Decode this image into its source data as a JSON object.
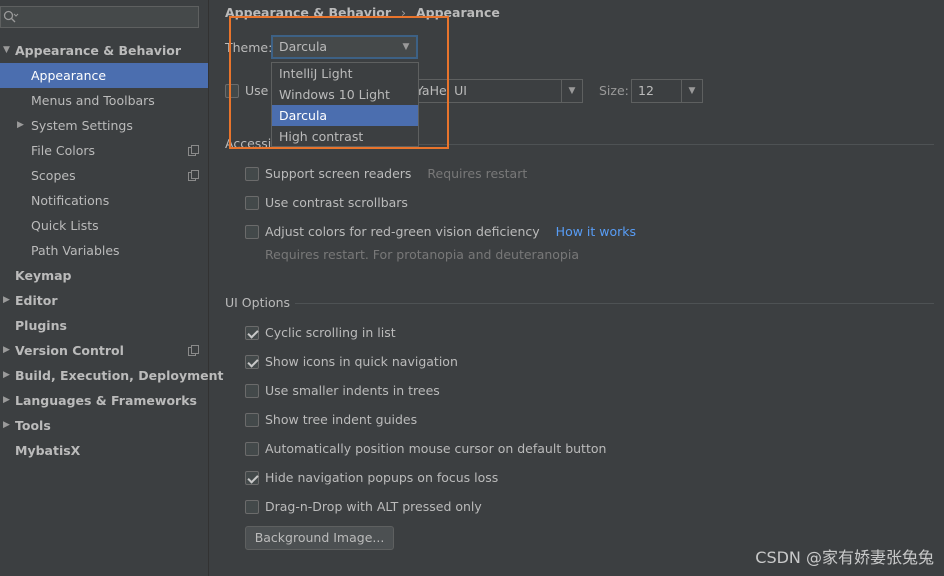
{
  "sidebar": {
    "search_placeholder": "",
    "items": [
      {
        "label": "Appearance & Behavior",
        "expanded": true
      },
      {
        "label": "Appearance"
      },
      {
        "label": "Menus and Toolbars"
      },
      {
        "label": "System Settings"
      },
      {
        "label": "File Colors"
      },
      {
        "label": "Scopes"
      },
      {
        "label": "Notifications"
      },
      {
        "label": "Quick Lists"
      },
      {
        "label": "Path Variables"
      },
      {
        "label": "Keymap"
      },
      {
        "label": "Editor"
      },
      {
        "label": "Plugins"
      },
      {
        "label": "Version Control"
      },
      {
        "label": "Build, Execution, Deployment"
      },
      {
        "label": "Languages & Frameworks"
      },
      {
        "label": "Tools"
      },
      {
        "label": "MybatisX"
      }
    ]
  },
  "breadcrumb": {
    "parent": "Appearance & Behavior",
    "separator": "›",
    "current": "Appearance"
  },
  "theme": {
    "label": "Theme:",
    "selected": "Darcula",
    "options": [
      "IntelliJ Light",
      "Windows 10 Light",
      "Darcula",
      "High contrast"
    ],
    "highlighted_option": "Darcula"
  },
  "font": {
    "use_custom_label_visible": "Use",
    "font_value_visible": "YaHei UI",
    "size_label": "Size:",
    "size_value": "12"
  },
  "accessibility": {
    "title_visible": "Accessi",
    "options": [
      {
        "label": "Support screen readers",
        "checked": false,
        "hint": "Requires restart"
      },
      {
        "label": "Use contrast scrollbars",
        "checked": false
      },
      {
        "label": "Adjust colors for red-green vision deficiency",
        "checked": false,
        "link": "How it works",
        "note": "Requires restart. For protanopia and deuteranopia"
      }
    ]
  },
  "ui_options": {
    "title": "UI Options",
    "options": [
      {
        "label": "Cyclic scrolling in list",
        "checked": true
      },
      {
        "label": "Show icons in quick navigation",
        "checked": true
      },
      {
        "label": "Use smaller indents in trees",
        "checked": false
      },
      {
        "label": "Show tree indent guides",
        "checked": false
      },
      {
        "label": "Automatically position mouse cursor on default button",
        "checked": false
      },
      {
        "label": "Hide navigation popups on focus loss",
        "checked": true
      },
      {
        "label": "Drag-n-Drop with ALT pressed only",
        "checked": false
      }
    ],
    "background_button": "Background Image..."
  },
  "watermark": "CSDN @家有娇妻张兔兔",
  "colors": {
    "selection": "#4b6eaf",
    "highlight_box": "#e8742c",
    "link": "#589df6",
    "background": "#3c3f41"
  }
}
